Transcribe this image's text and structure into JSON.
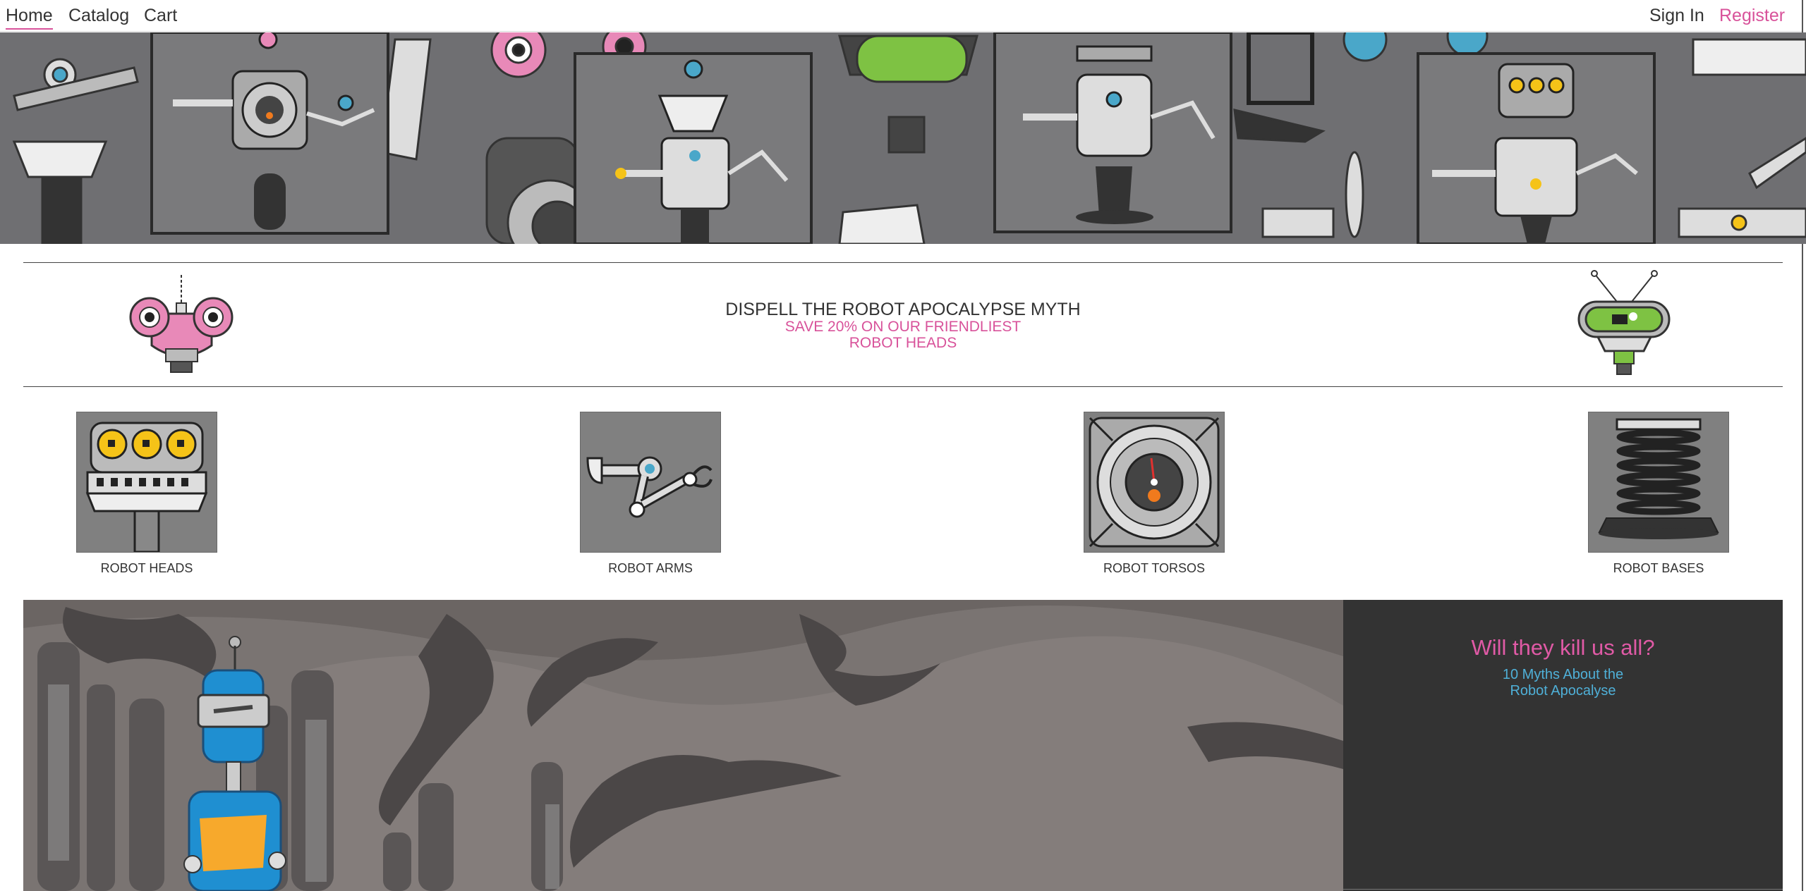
{
  "nav": {
    "home": "Home",
    "catalog": "Catalog",
    "cart": "Cart",
    "sign_in": "Sign In",
    "register": "Register"
  },
  "promo": {
    "title": "DISPELL THE ROBOT APOCALYPSE MYTH",
    "line1": "SAVE 20% ON OUR FRIENDLIEST",
    "line2": "ROBOT HEADS"
  },
  "categories": [
    {
      "label": "ROBOT HEADS",
      "icon": "robot-head-icon"
    },
    {
      "label": "ROBOT ARMS",
      "icon": "robot-arm-icon"
    },
    {
      "label": "ROBOT TORSOS",
      "icon": "robot-torso-icon"
    },
    {
      "label": "ROBOT BASES",
      "icon": "robot-base-icon"
    }
  ],
  "feature": {
    "heading": "Will they kill us all?",
    "sub_line1": "10 Myths About the",
    "sub_line2": "Robot Apocalyse"
  },
  "colors": {
    "accent": "#d8529a",
    "link": "#4fb0d8",
    "hero_bg": "#6f6f72",
    "sidebar_bg": "#333333"
  }
}
